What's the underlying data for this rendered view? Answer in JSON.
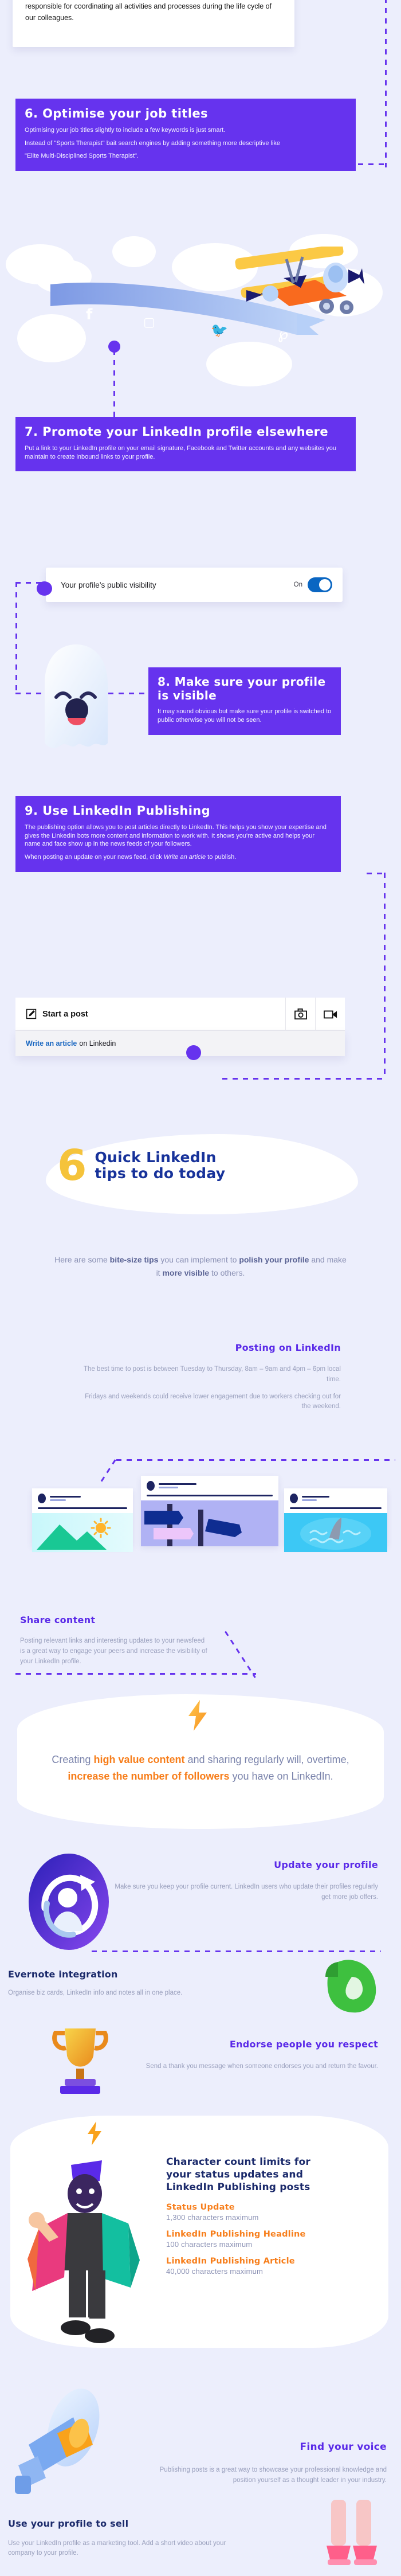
{
  "theme": {
    "bg": "#eceefc",
    "purple": "#6633ee",
    "accent_orange": "#f77e1b",
    "navy": "#1b2a6b",
    "muted": "#9aa0bd",
    "linkedin_blue": "#0a66c2"
  },
  "top_card": {
    "text": "onboarding, training and development, motivation and coaching. I am responsible for coordinating all activities and processes during the life cycle of our colleagues."
  },
  "section6": {
    "title": "6. Optimise your job titles",
    "para1": "Optimising your job titles slightly to include a few keywords is just smart.",
    "para2": "Instead of \"Sports Therapist\" bait search engines by adding something more descriptive like",
    "para3": "\"Elite Multi-Disciplined Sports Therapist\"."
  },
  "sky": {
    "social_icons": [
      "facebook-icon",
      "instagram-icon",
      "twitter-icon",
      "pinterest-icon"
    ],
    "glyphs": [
      "f",
      "▣",
      "ᵗ",
      "℗"
    ]
  },
  "section7": {
    "title": "7. Promote your LinkedIn profile elsewhere",
    "para1": "Put a link to your LinkedIn profile on your email signature, Facebook and Twitter accounts and any websites you maintain to create inbound links to your profile."
  },
  "visibility_card": {
    "label": "Your profile’s public visibility",
    "state_label": "On"
  },
  "section8": {
    "title": "8. Make sure your profile is visible",
    "para1": "It may sound obvious but make sure your profile is switched to public otherwise you will not be seen."
  },
  "section9": {
    "title": "9. Use LinkedIn Publishing",
    "para1": "The publishing option allows you to post articles directly to LinkedIn. This helps you show your expertise and gives the LinkedIn bots more content and information to work with. It shows you're active and helps your name and face show up in the news feeds of your followers.",
    "para2_before": "When posting an update on your news feed, click ",
    "para2_italic": "Write an article",
    "para2_after": " to publish."
  },
  "post_widget": {
    "start_a_post": "Start a post",
    "photo_icon": "camera-icon",
    "video_icon": "video-camera-icon",
    "write_article": "Write an article",
    "on_linkedin": "on Linkedin"
  },
  "quick_tips": {
    "number": "6",
    "title_line1": "Quick LinkedIn",
    "title_line2": "tips to do today",
    "lead_1": "Here are some ",
    "lead_1_b": "bite-size tips",
    "lead_2": " you can implement to ",
    "lead_2_b": "polish your profile",
    "lead_3": " and make it ",
    "lead_3_b": "more visible",
    "lead_4": " to others."
  },
  "posting": {
    "heading": "Posting on LinkedIn",
    "para1": "The best time to post is between Tuesday to Thursday, 8am – 9am and 4pm – 6pm local time.",
    "para2": "Fridays and weekends could receive lower engagement due to workers checking out for the weekend."
  },
  "share_content": {
    "heading": "Share content",
    "para1": "Posting relevant links and interesting updates to your newsfeed is a great way to engage your peers and increase the visibility of your LinkedIn profile."
  },
  "high_value": {
    "icon": "lightning-bolt-icon",
    "t1": "Creating ",
    "b1": "high value content",
    "t2": " and sharing regularly will, overtime, ",
    "b2": "increase the number of followers",
    "t3": " you have on LinkedIn."
  },
  "update_profile": {
    "icon": "refresh-user-icon",
    "heading": "Update your profile",
    "para1": "Make sure you keep your profile current. LinkedIn users who update their profiles regularly get more job offers."
  },
  "evernote": {
    "icon": "evernote-elephant-icon",
    "heading": "Evernote integration",
    "para1": "Organise biz cards, LinkedIn info and notes all in one place."
  },
  "endorse": {
    "icon": "trophy-icon",
    "heading": "Endorse people you respect",
    "para1": "Send a thank you message when someone endorses you and return the favour."
  },
  "character_limits": {
    "icon": "lightning-bolt-icon",
    "heading_line1": "Character count limits for",
    "heading_line2": "your status updates and",
    "heading_line3": "LinkedIn Publishing posts",
    "items": [
      {
        "label": "Status Update",
        "value": "1,300 characters maximum"
      },
      {
        "label": "LinkedIn Publishing Headline",
        "value": "100 characters maximum"
      },
      {
        "label": "LinkedIn Publishing Article",
        "value": "40,000 characters maximum"
      }
    ]
  },
  "find_voice": {
    "icon": "megaphone-icon",
    "heading": "Find your voice",
    "para1": "Publishing posts is a great way to showcase your professional knowledge and position yourself as a thought leader in your industry."
  },
  "use_profile_sell": {
    "heading": "Use your profile to sell",
    "para1": "Use your LinkedIn profile as a marketing tool. Add a short video about your company to your profile."
  }
}
